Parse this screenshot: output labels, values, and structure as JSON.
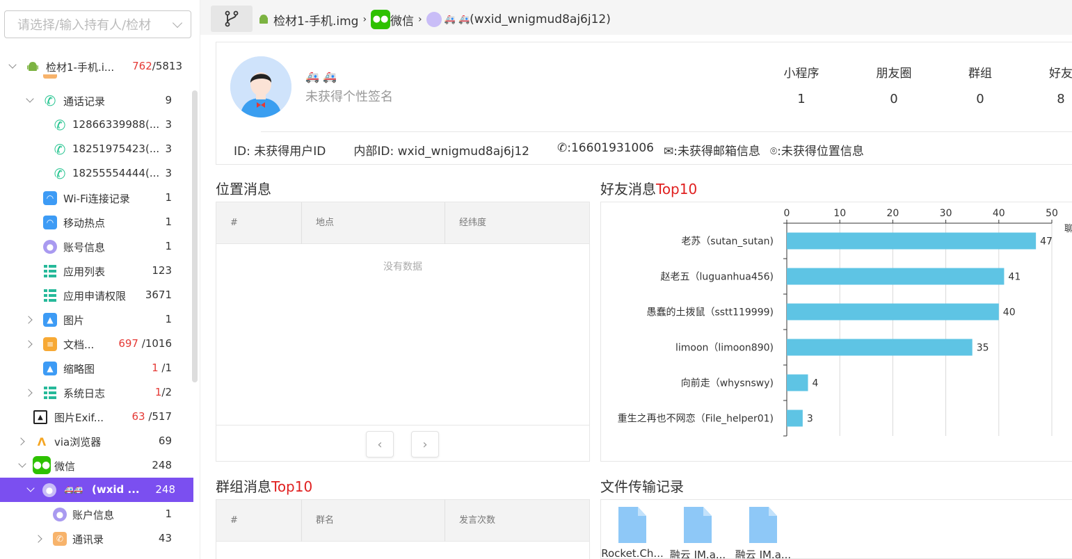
{
  "sidebar": {
    "search_placeholder": "请选择/输入持有人/检材",
    "tree": [
      {
        "label": "检材1-手机.i...",
        "count_red": "762",
        "count": "/5813"
      },
      {
        "label": "通话记录",
        "count": "9"
      },
      {
        "label": "12866339988(...",
        "count": "3"
      },
      {
        "label": "18251975423(...",
        "count": "3"
      },
      {
        "label": "18255554444(...",
        "count": "3"
      },
      {
        "label": "Wi-Fi连接记录",
        "count": "1"
      },
      {
        "label": "移动热点",
        "count": "1"
      },
      {
        "label": "账号信息",
        "count": "1"
      },
      {
        "label": "应用列表",
        "count": "123"
      },
      {
        "label": "应用申请权限",
        "count": "3671"
      },
      {
        "label": "图片",
        "count": "1"
      },
      {
        "label": "文档...",
        "count_red": "697",
        "count": "/1016"
      },
      {
        "label": "缩略图",
        "count_red": "1",
        "count": "/1"
      },
      {
        "label": "系统日志",
        "count_red": "1",
        "count": "/2"
      },
      {
        "label": "图片Exif...",
        "count_red": "63",
        "count": "/517"
      },
      {
        "label": "via浏览器",
        "count": "69"
      },
      {
        "label": "微信",
        "count": "248"
      },
      {
        "label": "(wxid ...",
        "count": "248"
      },
      {
        "label": "账户信息",
        "count": "1"
      },
      {
        "label": "通讯录",
        "count": "43"
      }
    ]
  },
  "breadcrumb": {
    "device": "检材1-手机.img",
    "app": "微信",
    "account": "(wxid_wnigmud8aj6j12)"
  },
  "profile": {
    "signature": "未获得个性签名",
    "stats": [
      {
        "label": "小程序",
        "value": "1"
      },
      {
        "label": "朋友圈",
        "value": "0"
      },
      {
        "label": "群组",
        "value": "0"
      },
      {
        "label": "好友",
        "value": "8"
      }
    ],
    "id": "ID: 未获得用户ID",
    "internal_id": "内部ID: wxid_wnigmud8aj6j12",
    "phone": ":16601931006",
    "email": ":未获得邮箱信息",
    "location": ":未获得位置信息"
  },
  "location_section": {
    "title": "位置消息",
    "columns": [
      "#",
      "地点",
      "经纬度"
    ],
    "empty_text": "没有数据"
  },
  "friend_section": {
    "title_prefix": "好友消息",
    "title_red": "Top10"
  },
  "group_section": {
    "title_prefix": "群组消息",
    "title_red": "Top10",
    "columns": [
      "#",
      "群名",
      "发言次数"
    ]
  },
  "files_section": {
    "title": "文件传输记录",
    "files": [
      "Rocket.Ch...",
      "融云 IM.a...",
      "融云 IM.a..."
    ]
  },
  "chart_data": {
    "type": "bar",
    "orientation": "horizontal",
    "categories": [
      "老苏（sutan_sutan)",
      "赵老五（luguanhua456)",
      "愚蠢的土拨鼠（sstt119999)",
      "limoon（limoon890)",
      "向前走（whysnswy)",
      "重生之再也不网恋（File_helper01)"
    ],
    "values": [
      47,
      41,
      40,
      35,
      4,
      3
    ],
    "xlim": [
      0,
      50
    ],
    "xticks": [
      "0",
      "10",
      "20",
      "30",
      "40",
      "50"
    ],
    "xlabel": "聊",
    "grid": true,
    "bar_color": "#5ec4e4"
  },
  "colors": {
    "accent": "#7b4ff0",
    "red": "#e02020",
    "wechat": "#2dc100"
  }
}
